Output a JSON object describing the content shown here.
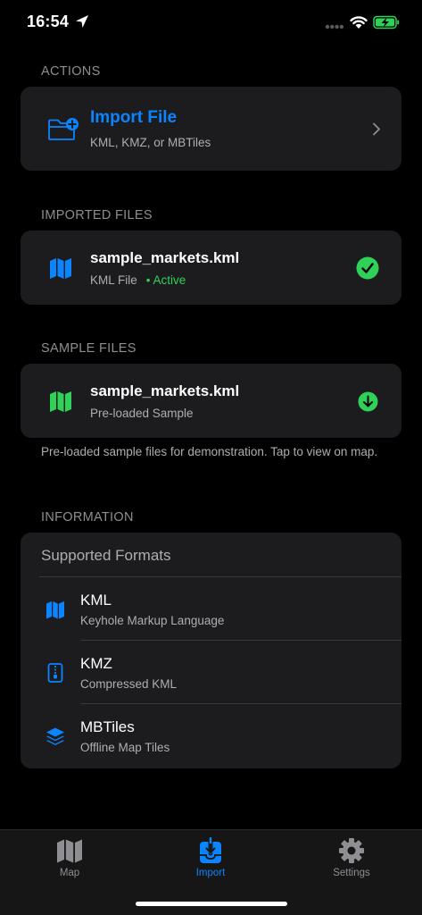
{
  "status": {
    "time": "16:54"
  },
  "sections": {
    "actions": "ACTIONS",
    "imported": "IMPORTED FILES",
    "samples": "SAMPLE FILES",
    "information": "INFORMATION"
  },
  "import_card": {
    "title": "Import File",
    "subtitle": "KML, KMZ, or MBTiles",
    "icon": "folder-plus-icon"
  },
  "imported_file": {
    "name": "sample_markets.kml",
    "type": "KML File",
    "dot": "•",
    "status": "Active",
    "icon": "map-icon"
  },
  "sample_file": {
    "name": "sample_markets.kml",
    "subtitle": "Pre-loaded Sample",
    "icon": "map-icon"
  },
  "samples_footer": "Pre-loaded sample files for demonstration. Tap to view on map.",
  "info": {
    "title": "Supported Formats",
    "formats": [
      {
        "name": "KML",
        "desc": "Keyhole Markup Language",
        "icon": "map-icon"
      },
      {
        "name": "KMZ",
        "desc": "Compressed KML",
        "icon": "zip-file-icon"
      },
      {
        "name": "MBTiles",
        "desc": "Offline Map Tiles",
        "icon": "layers-icon"
      }
    ]
  },
  "tabs": [
    {
      "label": "Map",
      "icon": "map-icon",
      "selected": false
    },
    {
      "label": "Import",
      "icon": "import-tray-icon",
      "selected": true
    },
    {
      "label": "Settings",
      "icon": "gear-icon",
      "selected": false
    }
  ],
  "colors": {
    "accent": "#0a84ff",
    "success": "#30d158",
    "background": "#000000",
    "card": "#1c1c1e",
    "secondary_text": "#aeaeb2",
    "tab_inactive": "#8e8e93"
  }
}
